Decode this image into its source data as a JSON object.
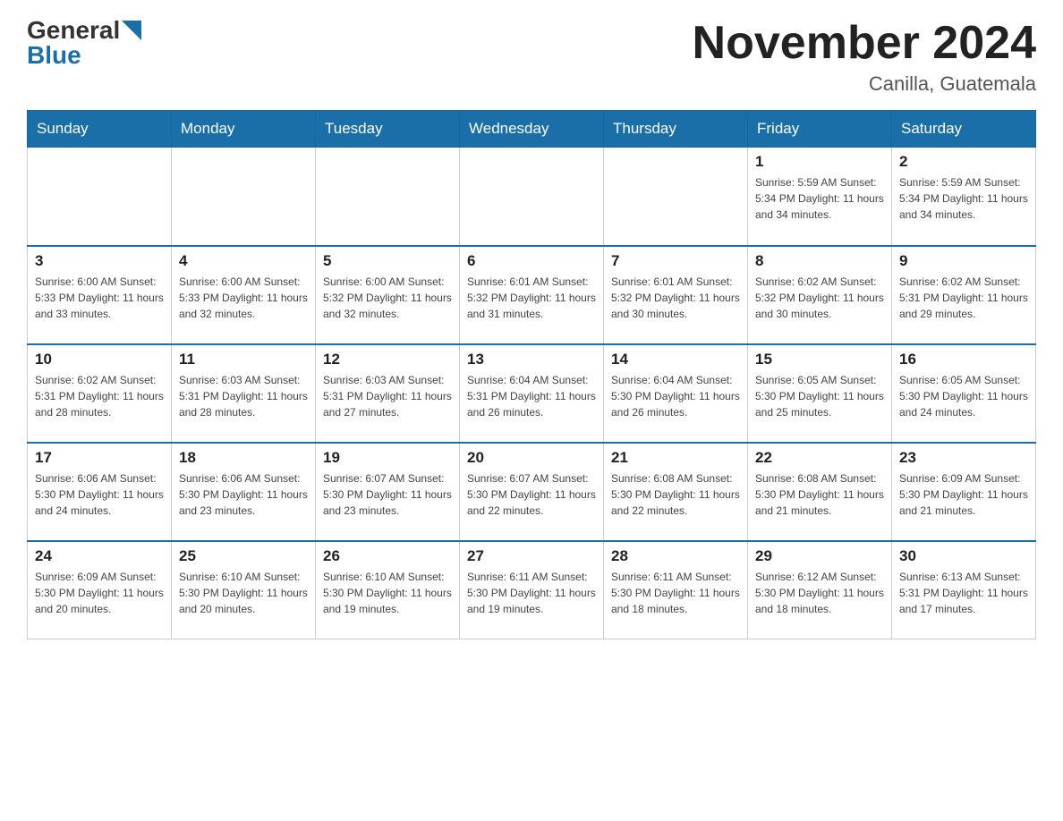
{
  "header": {
    "logo_general": "General",
    "logo_blue": "Blue",
    "title": "November 2024",
    "subtitle": "Canilla, Guatemala"
  },
  "days_of_week": [
    "Sunday",
    "Monday",
    "Tuesday",
    "Wednesday",
    "Thursday",
    "Friday",
    "Saturday"
  ],
  "weeks": [
    [
      {
        "day": "",
        "info": ""
      },
      {
        "day": "",
        "info": ""
      },
      {
        "day": "",
        "info": ""
      },
      {
        "day": "",
        "info": ""
      },
      {
        "day": "",
        "info": ""
      },
      {
        "day": "1",
        "info": "Sunrise: 5:59 AM\nSunset: 5:34 PM\nDaylight: 11 hours and 34 minutes."
      },
      {
        "day": "2",
        "info": "Sunrise: 5:59 AM\nSunset: 5:34 PM\nDaylight: 11 hours and 34 minutes."
      }
    ],
    [
      {
        "day": "3",
        "info": "Sunrise: 6:00 AM\nSunset: 5:33 PM\nDaylight: 11 hours and 33 minutes."
      },
      {
        "day": "4",
        "info": "Sunrise: 6:00 AM\nSunset: 5:33 PM\nDaylight: 11 hours and 32 minutes."
      },
      {
        "day": "5",
        "info": "Sunrise: 6:00 AM\nSunset: 5:32 PM\nDaylight: 11 hours and 32 minutes."
      },
      {
        "day": "6",
        "info": "Sunrise: 6:01 AM\nSunset: 5:32 PM\nDaylight: 11 hours and 31 minutes."
      },
      {
        "day": "7",
        "info": "Sunrise: 6:01 AM\nSunset: 5:32 PM\nDaylight: 11 hours and 30 minutes."
      },
      {
        "day": "8",
        "info": "Sunrise: 6:02 AM\nSunset: 5:32 PM\nDaylight: 11 hours and 30 minutes."
      },
      {
        "day": "9",
        "info": "Sunrise: 6:02 AM\nSunset: 5:31 PM\nDaylight: 11 hours and 29 minutes."
      }
    ],
    [
      {
        "day": "10",
        "info": "Sunrise: 6:02 AM\nSunset: 5:31 PM\nDaylight: 11 hours and 28 minutes."
      },
      {
        "day": "11",
        "info": "Sunrise: 6:03 AM\nSunset: 5:31 PM\nDaylight: 11 hours and 28 minutes."
      },
      {
        "day": "12",
        "info": "Sunrise: 6:03 AM\nSunset: 5:31 PM\nDaylight: 11 hours and 27 minutes."
      },
      {
        "day": "13",
        "info": "Sunrise: 6:04 AM\nSunset: 5:31 PM\nDaylight: 11 hours and 26 minutes."
      },
      {
        "day": "14",
        "info": "Sunrise: 6:04 AM\nSunset: 5:30 PM\nDaylight: 11 hours and 26 minutes."
      },
      {
        "day": "15",
        "info": "Sunrise: 6:05 AM\nSunset: 5:30 PM\nDaylight: 11 hours and 25 minutes."
      },
      {
        "day": "16",
        "info": "Sunrise: 6:05 AM\nSunset: 5:30 PM\nDaylight: 11 hours and 24 minutes."
      }
    ],
    [
      {
        "day": "17",
        "info": "Sunrise: 6:06 AM\nSunset: 5:30 PM\nDaylight: 11 hours and 24 minutes."
      },
      {
        "day": "18",
        "info": "Sunrise: 6:06 AM\nSunset: 5:30 PM\nDaylight: 11 hours and 23 minutes."
      },
      {
        "day": "19",
        "info": "Sunrise: 6:07 AM\nSunset: 5:30 PM\nDaylight: 11 hours and 23 minutes."
      },
      {
        "day": "20",
        "info": "Sunrise: 6:07 AM\nSunset: 5:30 PM\nDaylight: 11 hours and 22 minutes."
      },
      {
        "day": "21",
        "info": "Sunrise: 6:08 AM\nSunset: 5:30 PM\nDaylight: 11 hours and 22 minutes."
      },
      {
        "day": "22",
        "info": "Sunrise: 6:08 AM\nSunset: 5:30 PM\nDaylight: 11 hours and 21 minutes."
      },
      {
        "day": "23",
        "info": "Sunrise: 6:09 AM\nSunset: 5:30 PM\nDaylight: 11 hours and 21 minutes."
      }
    ],
    [
      {
        "day": "24",
        "info": "Sunrise: 6:09 AM\nSunset: 5:30 PM\nDaylight: 11 hours and 20 minutes."
      },
      {
        "day": "25",
        "info": "Sunrise: 6:10 AM\nSunset: 5:30 PM\nDaylight: 11 hours and 20 minutes."
      },
      {
        "day": "26",
        "info": "Sunrise: 6:10 AM\nSunset: 5:30 PM\nDaylight: 11 hours and 19 minutes."
      },
      {
        "day": "27",
        "info": "Sunrise: 6:11 AM\nSunset: 5:30 PM\nDaylight: 11 hours and 19 minutes."
      },
      {
        "day": "28",
        "info": "Sunrise: 6:11 AM\nSunset: 5:30 PM\nDaylight: 11 hours and 18 minutes."
      },
      {
        "day": "29",
        "info": "Sunrise: 6:12 AM\nSunset: 5:30 PM\nDaylight: 11 hours and 18 minutes."
      },
      {
        "day": "30",
        "info": "Sunrise: 6:13 AM\nSunset: 5:31 PM\nDaylight: 11 hours and 17 minutes."
      }
    ]
  ]
}
